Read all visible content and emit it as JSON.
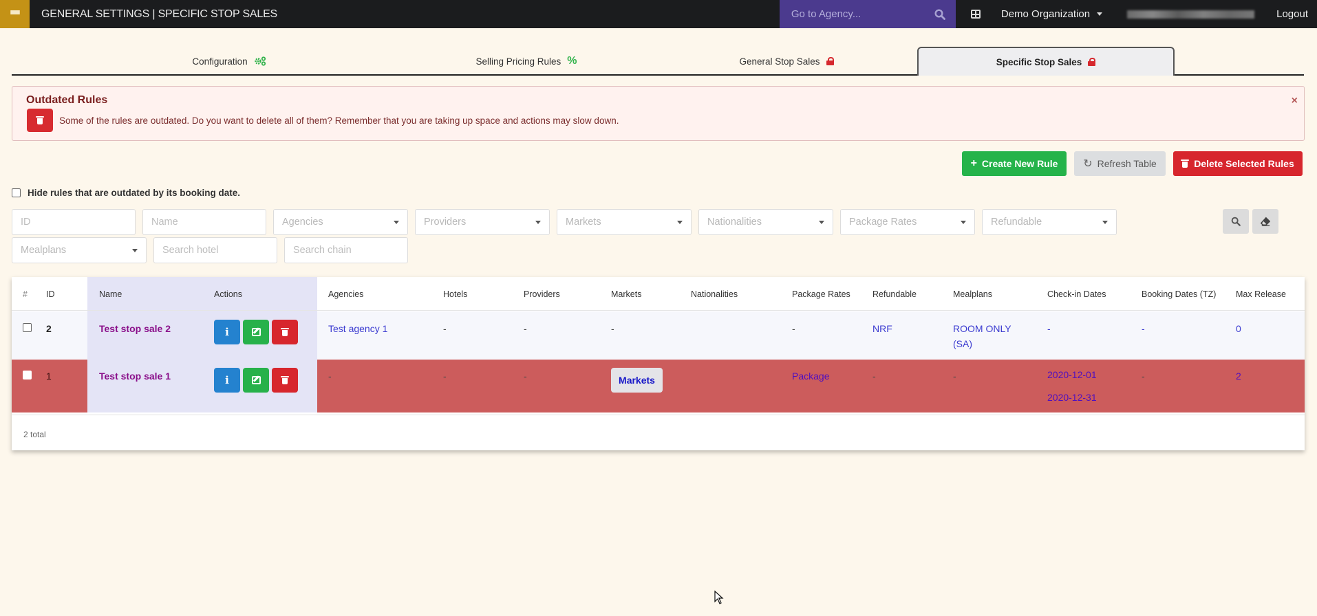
{
  "navbar": {
    "menu_icon": "hamburger-icon",
    "title": "GENERAL SETTINGS | SPECIFIC STOP SALES",
    "agency_search_placeholder": "Go to Agency...",
    "organization": "Demo Organization",
    "logout": "Logout",
    "colors": {
      "bar": "#1b1c1e",
      "menu": "#c49216",
      "search": "#4b3a8e"
    }
  },
  "tabs": [
    {
      "label": "Configuration",
      "icon": "gears-icon",
      "active": false
    },
    {
      "label": "Selling Pricing Rules",
      "icon": "percent-icon",
      "active": false
    },
    {
      "label": "General Stop Sales",
      "icon": "lock-icon",
      "active": false
    },
    {
      "label": "Specific Stop Sales",
      "icon": "lock-icon",
      "active": true
    }
  ],
  "alert": {
    "title": "Outdated Rules",
    "message": "Some of the rules are outdated. Do you want to delete all of them? Remember that you are taking up space and actions may slow down.",
    "close": "×"
  },
  "actions": {
    "create": "Create New Rule",
    "refresh": "Refresh Table",
    "delete_selected": "Delete Selected Rules"
  },
  "hide_outdated": {
    "label": "Hide rules that are outdated by its booking date.",
    "checked": false
  },
  "filters": {
    "id_placeholder": "ID",
    "name_placeholder": "Name",
    "agencies": "Agencies",
    "providers": "Providers",
    "markets": "Markets",
    "nationalities": "Nationalities",
    "package_rates": "Package Rates",
    "refundable": "Refundable",
    "mealplans": "Mealplans",
    "hotel_placeholder": "Search hotel",
    "chain_placeholder": "Search chain"
  },
  "table": {
    "columns": [
      "#",
      "ID",
      "Name",
      "Actions",
      "Agencies",
      "Hotels",
      "Providers",
      "Markets",
      "Nationalities",
      "Package Rates",
      "Refundable",
      "Mealplans",
      "Check-in Dates",
      "Booking Dates (TZ)",
      "Max Release"
    ],
    "rows": [
      {
        "id": "2",
        "name": "Test stop sale 2",
        "outdated": false,
        "agencies": "Test agency 1",
        "hotels": "-",
        "providers": "-",
        "markets": "-",
        "nationalities": "",
        "package_rates": "-",
        "refundable": "NRF",
        "mealplans_line1": "ROOM ONLY",
        "mealplans_line2": "(SA)",
        "checkin_from": "-",
        "checkin_to": "",
        "booking_dates": "-",
        "max_release": "0"
      },
      {
        "id": "1",
        "name": "Test stop sale 1",
        "outdated": true,
        "agencies": "-",
        "hotels": "-",
        "providers": "-",
        "markets_button": "Markets",
        "nationalities": "",
        "package_rates": "Package",
        "refundable": "-",
        "mealplans": "-",
        "checkin_from": "2020-12-01",
        "checkin_to": "2020-12-31",
        "booking_dates": "-",
        "max_release": "2"
      }
    ],
    "total": "2 total"
  }
}
